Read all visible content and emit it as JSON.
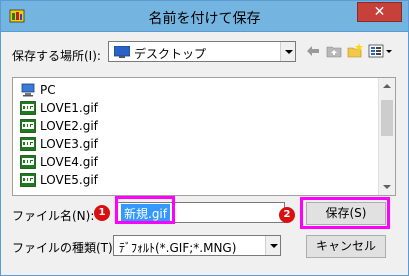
{
  "window": {
    "title": "名前を付けて保存",
    "close_glyph": "✕"
  },
  "location": {
    "label": "保存する場所(I):",
    "selected": "デスクトップ"
  },
  "toolbar": {
    "icons": [
      "back-arrow-icon",
      "up-folder-icon",
      "new-folder-icon",
      "view-menu-icon"
    ]
  },
  "file_list": {
    "items": [
      {
        "label": "PC",
        "icon": "computer-icon"
      },
      {
        "label": "LOVE1.gif",
        "icon": "gif-file-icon"
      },
      {
        "label": "LOVE2.gif",
        "icon": "gif-file-icon"
      },
      {
        "label": "LOVE3.gif",
        "icon": "gif-file-icon"
      },
      {
        "label": "LOVE4.gif",
        "icon": "gif-file-icon"
      },
      {
        "label": "LOVE5.gif",
        "icon": "gif-file-icon"
      }
    ]
  },
  "filename": {
    "label": "ファイル名(N):",
    "value": "新規.gif"
  },
  "filetype": {
    "label": "ファイルの種類(T):",
    "selected": "ﾃﾞﾌｫﾙﾄ(*.GIF;*.MNG)"
  },
  "buttons": {
    "save": "保存(S)",
    "cancel": "キャンセル"
  },
  "markers": {
    "one": "1",
    "two": "2"
  },
  "colors": {
    "highlight": "#ff00ff",
    "marker": "#d81010",
    "titlebar": "#74b4e0"
  }
}
